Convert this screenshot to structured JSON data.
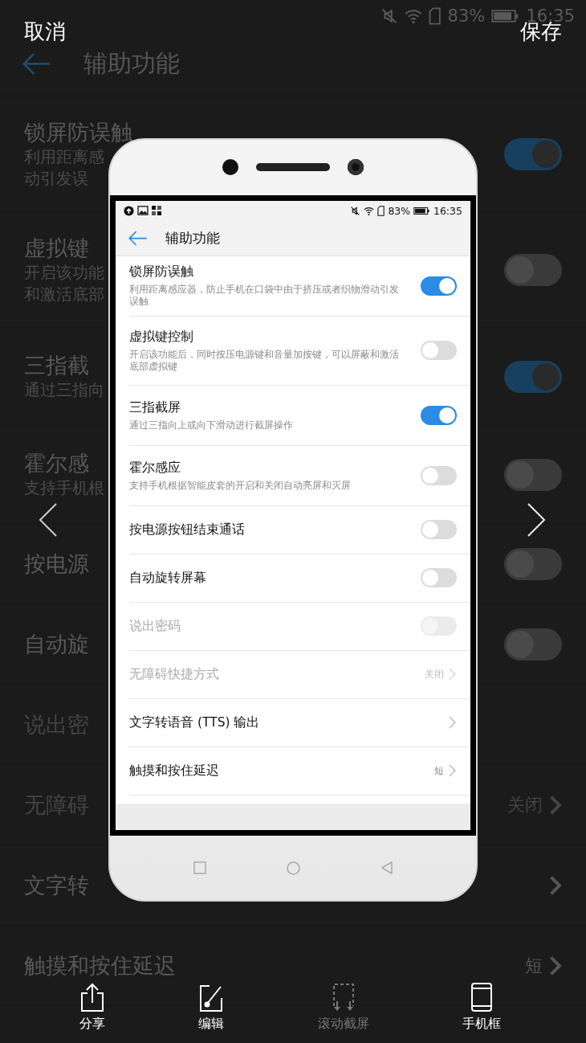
{
  "top_bar": {
    "cancel": "取消",
    "save": "保存"
  },
  "background_screen": {
    "status_bar": {
      "battery": "83%",
      "time": "16:35"
    },
    "title": "辅助功能",
    "rows": [
      {
        "title": "锁屏防误触",
        "subtitle_lines": [
          "利用距离感",
          "动引发误"
        ],
        "kind": "toggle",
        "on": true
      },
      {
        "title": "虚拟键",
        "subtitle_lines": [
          "开启该功能",
          "和激活底部"
        ],
        "kind": "toggle",
        "on": false
      },
      {
        "title": "三指截",
        "subtitle_lines": [
          "通过三指向"
        ],
        "kind": "toggle",
        "on": true
      },
      {
        "title": "霍尔感",
        "subtitle_lines": [
          "支持手机根"
        ],
        "kind": "toggle",
        "on": false
      },
      {
        "title": "按电源",
        "kind": "toggle",
        "on": false
      },
      {
        "title": "自动旋",
        "kind": "toggle",
        "on": false
      },
      {
        "title": "说出密",
        "kind": "text",
        "disabled": true
      },
      {
        "title": "无障碍",
        "kind": "link",
        "value": "关闭",
        "disabled": true
      },
      {
        "title": "文字转",
        "kind": "link",
        "disabled": false
      },
      {
        "title": "触摸和按住延迟",
        "kind": "link",
        "value": "短",
        "disabled": false
      }
    ]
  },
  "phone_preview": {
    "status_bar": {
      "battery": "83%",
      "time": "16:35"
    },
    "title": "辅助功能",
    "rows": [
      {
        "title": "锁屏防误触",
        "subtitle": "利用距离感应器，防止手机在口袋中由于挤压或者织物滑动引发误触",
        "kind": "toggle",
        "on": true,
        "disabled": false
      },
      {
        "title": "虚拟键控制",
        "subtitle": "开启该功能后，同时按压电源键和音量加按键，可以屏蔽和激活底部虚拟键",
        "kind": "toggle",
        "on": false,
        "disabled": false
      },
      {
        "title": "三指截屏",
        "subtitle": "通过三指向上或向下滑动进行截屏操作",
        "kind": "toggle",
        "on": true,
        "disabled": false
      },
      {
        "title": "霍尔感应",
        "subtitle": "支持手机根据智能皮套的开启和关闭自动亮屏和灭屏",
        "kind": "toggle",
        "on": false,
        "disabled": false
      },
      {
        "title": "按电源按钮结束通话",
        "kind": "toggle",
        "on": false,
        "disabled": false
      },
      {
        "title": "自动旋转屏幕",
        "kind": "toggle",
        "on": false,
        "disabled": false
      },
      {
        "title": "说出密码",
        "kind": "toggle",
        "disabled": true
      },
      {
        "title": "无障碍快捷方式",
        "kind": "link",
        "value": "关闭",
        "disabled": true
      },
      {
        "title": "文字转语音 (TTS) 输出",
        "kind": "link",
        "disabled": false
      },
      {
        "title": "触摸和按住延迟",
        "kind": "link",
        "value": "短",
        "disabled": false
      }
    ]
  },
  "toolbar": [
    {
      "kind": "share",
      "label": "分享",
      "disabled": false
    },
    {
      "kind": "edit",
      "label": "编辑",
      "disabled": false
    },
    {
      "kind": "scroll",
      "label": "滚动截屏",
      "disabled": true
    },
    {
      "kind": "frame",
      "label": "手机框",
      "disabled": false
    }
  ]
}
